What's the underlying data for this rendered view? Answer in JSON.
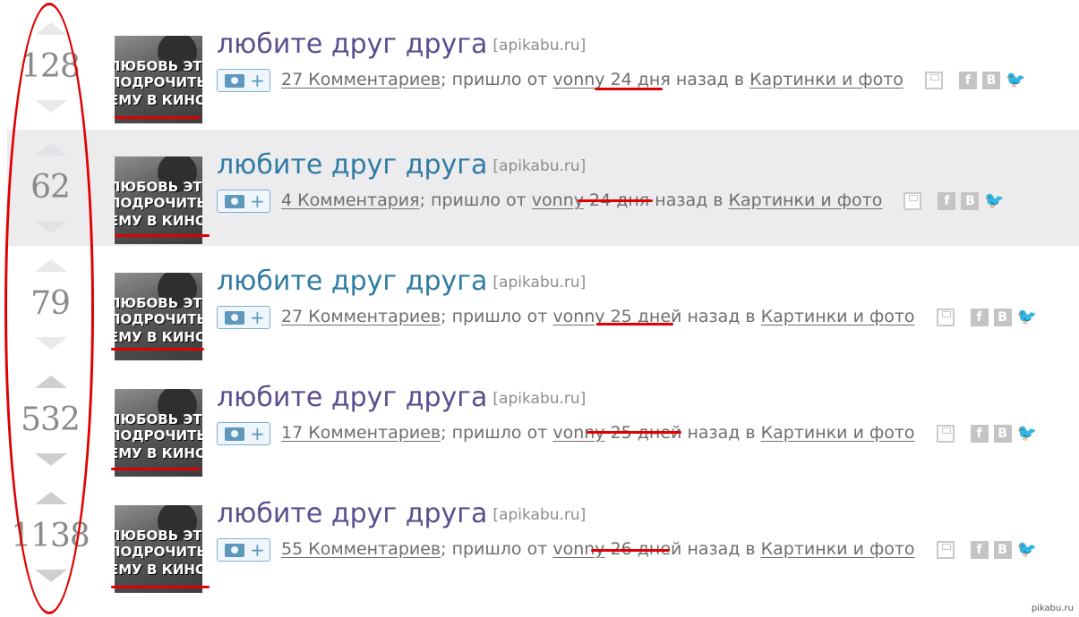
{
  "posts": [
    {
      "rating": "128",
      "thumb_lines": [
        "ЛЮБОВЬ ЭТО",
        "ПОДРОЧИТЬ",
        "ЕМУ В КИНО"
      ],
      "title": "любите друг друга",
      "domain": "[apikabu.ru]",
      "comments": "27 Комментариев",
      "sep": "; пришло от ",
      "author": "vonny",
      "age": "24 дня",
      "age_suffix": " назад в ",
      "category": "Картинки и фото",
      "add_plus": "+",
      "fb": "f",
      "vk": "B",
      "tw": "🐦"
    },
    {
      "rating": "62",
      "thumb_lines": [
        "ЛЮБОВЬ ЭТО",
        "ПОДРОЧИТЬ",
        "ЕМУ В КИНО"
      ],
      "title": "любите друг друга",
      "domain": "[apikabu.ru]",
      "comments": "4 Комментария",
      "sep": "; пришло от ",
      "author": "vonny",
      "age": "24 дня",
      "age_suffix": " назад в ",
      "category": "Картинки и фото",
      "add_plus": "+",
      "fb": "f",
      "vk": "B",
      "tw": "🐦"
    },
    {
      "rating": "79",
      "thumb_lines": [
        "ЛЮБОВЬ ЭТО",
        "ПОДРОЧИТЬ",
        "ЕМУ В КИНО"
      ],
      "title": "любите друг друга",
      "domain": "[apikabu.ru]",
      "comments": "27 Комментариев",
      "sep": "; пришло от ",
      "author": "vonny",
      "age": "25 дней",
      "age_suffix": " назад в ",
      "category": "Картинки и фото",
      "add_plus": "+",
      "fb": "f",
      "vk": "B",
      "tw": "🐦"
    },
    {
      "rating": "532",
      "thumb_lines": [
        "ЛЮБОВЬ ЭТО",
        "ПОДРОЧИТЬ",
        "ЕМУ В КИНО"
      ],
      "title": "любите друг друга",
      "domain": "[apikabu.ru]",
      "comments": "17 Комментариев",
      "sep": "; пришло от ",
      "author": "vonny",
      "age": "25 дней",
      "age_suffix": " назад в ",
      "category": "Картинки и фото",
      "add_plus": "+",
      "fb": "f",
      "vk": "B",
      "tw": "🐦"
    },
    {
      "rating": "1138",
      "thumb_lines": [
        "ЛЮБОВЬ ЭТО",
        "ПОДРОЧИТЬ",
        "ЕМУ В КИНО"
      ],
      "title": "любите друг друга",
      "domain": "[apikabu.ru]",
      "comments": "55 Комментариев",
      "sep": "; пришло от ",
      "author": "vonny",
      "age": "26 дней",
      "age_suffix": " назад в ",
      "category": "Картинки и фото",
      "add_plus": "+",
      "fb": "f",
      "vk": "B",
      "tw": "🐦"
    }
  ],
  "watermark": "pikabu.ru",
  "colors": {
    "title_unvisited": "#5d4d8f",
    "title_visited": "#2f7ba3",
    "annotation_red": "#e10000",
    "alt_row_bg": "#ececef"
  }
}
